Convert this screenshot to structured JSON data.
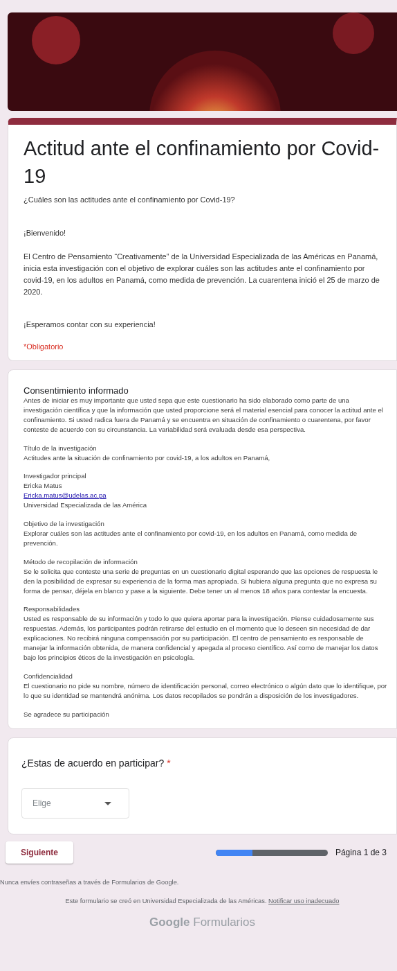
{
  "header": {
    "title": "Actitud ante el confinamiento por Covid-19",
    "subtitle": "¿Cuáles son las actitudes ante el confinamiento por Covid-19?",
    "paragraphs": [
      "¡Bienvenido!",
      "El Centro de Pensamiento “Creativamente” de la Universidad Especializada de las Américas en Panamá, inicia esta investigación con el objetivo de explorar cuáles son las actitudes ante el confinamiento por covid-19, en los adultos en Panamá, como medida de prevención. La cuarentena inició el 25 de marzo de 2020.",
      "¡Esperamos contar con su experiencia!"
    ],
    "required_note": "*Obligatorio"
  },
  "consent": {
    "title": "Consentimiento informado",
    "sections": [
      {
        "lines": [
          {
            "kind": "text",
            "text": "Antes de iniciar es muy importante que usted sepa que este cuestionario ha sido elaborado como parte de una investigación científica y que la información que usted proporcione será el material esencial para conocer la actitud ante el confinamiento. Si usted radica fuera de Panamá y se encuentra en situación de confinamiento o cuarentena, por favor conteste de acuerdo con su circunstancia. La variabilidad será evaluada desde esa perspectiva."
          }
        ]
      },
      {
        "lines": [
          {
            "kind": "text",
            "text": "Título de la investigación"
          },
          {
            "kind": "text",
            "text": "Actitudes ante la situación de confinamiento  por covid-19, a los adultos en Panamá,"
          }
        ]
      },
      {
        "lines": [
          {
            "kind": "text",
            "text": "Investigador principal"
          },
          {
            "kind": "text",
            "text": "Ericka Matus"
          },
          {
            "kind": "link",
            "text": "Ericka.matus@udelas.ac.pa"
          },
          {
            "kind": "text",
            "text": "Universidad Especializada de las América"
          }
        ]
      },
      {
        "lines": [
          {
            "kind": "text",
            "text": "Objetivo de la investigación"
          },
          {
            "kind": "text",
            "text": "Explorar cuáles son las actitudes ante el confinamiento por covid-19, en los adultos en Panamá, como medida de prevención."
          }
        ]
      },
      {
        "lines": [
          {
            "kind": "text",
            "text": "Método de recopilación de información"
          },
          {
            "kind": "text",
            "text": "Se le solicita que conteste una serie de preguntas en un cuestionario digital esperando que las opciones de respuesta le den la posibilidad de expresar su experiencia de la forma mas apropiada. Si hubiera alguna pregunta que no expresa su forma de pensar, déjela en blanco y pase a la siguiente. Debe tener un al menos 18 años para contestar la encuesta."
          }
        ]
      },
      {
        "lines": [
          {
            "kind": "text",
            "text": "Responsabilidades"
          },
          {
            "kind": "text",
            "text": "Usted es responsable de su información y todo lo que quiera aportar para la investigación. Piense cuidadosamente sus respuestas. Además, los participantes podrán retirarse del estudio en el momento que lo deseen sin necesidad de dar explicaciones. No recibirá ninguna compensación por su participación. El centro de pensamiento es responsable de manejar la información obtenida, de manera confidencial y apegada al proceso científico. Así como de manejar los datos bajo los principios éticos de la investigación en psicología."
          }
        ]
      },
      {
        "lines": [
          {
            "kind": "text",
            "text": "Confidencialidad"
          },
          {
            "kind": "text",
            "text": "El cuestionario no pide su nombre, número de identificación personal, correo electrónico o algún dato que lo identifique, por lo que su identidad se mantendrá anónima. Los datos recopilados se pondrán a disposición de los investigadores."
          }
        ]
      },
      {
        "lines": [
          {
            "kind": "text",
            "text": "Se agradece su participación"
          }
        ]
      }
    ]
  },
  "question": {
    "label": "¿Estas de acuerdo en participar?",
    "required": true,
    "required_mark": "*",
    "dropdown": {
      "placeholder": "Elige"
    }
  },
  "footer": {
    "next_button": "Siguiente",
    "progress": {
      "level": 0.33,
      "label": "Página 1 de 3"
    },
    "password_notice": "Nunca envíes contraseñas a través de Formularios de Google.",
    "created_note": "Este formulario se creó en Universidad Especializada de las Américas.",
    "report_link": "Notificar uso inadecuado",
    "logo": {
      "brand": "Google",
      "product": "Formularios"
    }
  }
}
